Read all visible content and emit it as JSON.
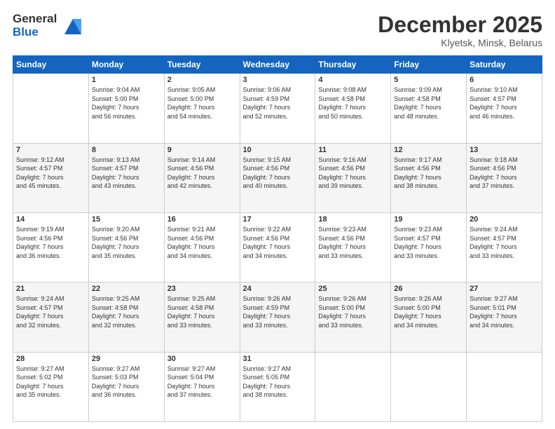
{
  "logo": {
    "general": "General",
    "blue": "Blue"
  },
  "header": {
    "month": "December 2025",
    "location": "Klyetsk, Minsk, Belarus"
  },
  "weekdays": [
    "Sunday",
    "Monday",
    "Tuesday",
    "Wednesday",
    "Thursday",
    "Friday",
    "Saturday"
  ],
  "weeks": [
    [
      {
        "day": "",
        "info": ""
      },
      {
        "day": "1",
        "info": "Sunrise: 9:04 AM\nSunset: 5:00 PM\nDaylight: 7 hours\nand 56 minutes."
      },
      {
        "day": "2",
        "info": "Sunrise: 9:05 AM\nSunset: 5:00 PM\nDaylight: 7 hours\nand 54 minutes."
      },
      {
        "day": "3",
        "info": "Sunrise: 9:06 AM\nSunset: 4:59 PM\nDaylight: 7 hours\nand 52 minutes."
      },
      {
        "day": "4",
        "info": "Sunrise: 9:08 AM\nSunset: 4:58 PM\nDaylight: 7 hours\nand 50 minutes."
      },
      {
        "day": "5",
        "info": "Sunrise: 9:09 AM\nSunset: 4:58 PM\nDaylight: 7 hours\nand 48 minutes."
      },
      {
        "day": "6",
        "info": "Sunrise: 9:10 AM\nSunset: 4:57 PM\nDaylight: 7 hours\nand 46 minutes."
      }
    ],
    [
      {
        "day": "7",
        "info": "Sunrise: 9:12 AM\nSunset: 4:57 PM\nDaylight: 7 hours\nand 45 minutes."
      },
      {
        "day": "8",
        "info": "Sunrise: 9:13 AM\nSunset: 4:57 PM\nDaylight: 7 hours\nand 43 minutes."
      },
      {
        "day": "9",
        "info": "Sunrise: 9:14 AM\nSunset: 4:56 PM\nDaylight: 7 hours\nand 42 minutes."
      },
      {
        "day": "10",
        "info": "Sunrise: 9:15 AM\nSunset: 4:56 PM\nDaylight: 7 hours\nand 40 minutes."
      },
      {
        "day": "11",
        "info": "Sunrise: 9:16 AM\nSunset: 4:56 PM\nDaylight: 7 hours\nand 39 minutes."
      },
      {
        "day": "12",
        "info": "Sunrise: 9:17 AM\nSunset: 4:56 PM\nDaylight: 7 hours\nand 38 minutes."
      },
      {
        "day": "13",
        "info": "Sunrise: 9:18 AM\nSunset: 4:56 PM\nDaylight: 7 hours\nand 37 minutes."
      }
    ],
    [
      {
        "day": "14",
        "info": "Sunrise: 9:19 AM\nSunset: 4:56 PM\nDaylight: 7 hours\nand 36 minutes."
      },
      {
        "day": "15",
        "info": "Sunrise: 9:20 AM\nSunset: 4:56 PM\nDaylight: 7 hours\nand 35 minutes."
      },
      {
        "day": "16",
        "info": "Sunrise: 9:21 AM\nSunset: 4:56 PM\nDaylight: 7 hours\nand 34 minutes."
      },
      {
        "day": "17",
        "info": "Sunrise: 9:22 AM\nSunset: 4:56 PM\nDaylight: 7 hours\nand 34 minutes."
      },
      {
        "day": "18",
        "info": "Sunrise: 9:23 AM\nSunset: 4:56 PM\nDaylight: 7 hours\nand 33 minutes."
      },
      {
        "day": "19",
        "info": "Sunrise: 9:23 AM\nSunset: 4:57 PM\nDaylight: 7 hours\nand 33 minutes."
      },
      {
        "day": "20",
        "info": "Sunrise: 9:24 AM\nSunset: 4:57 PM\nDaylight: 7 hours\nand 33 minutes."
      }
    ],
    [
      {
        "day": "21",
        "info": "Sunrise: 9:24 AM\nSunset: 4:57 PM\nDaylight: 7 hours\nand 32 minutes."
      },
      {
        "day": "22",
        "info": "Sunrise: 9:25 AM\nSunset: 4:58 PM\nDaylight: 7 hours\nand 32 minutes."
      },
      {
        "day": "23",
        "info": "Sunrise: 9:25 AM\nSunset: 4:58 PM\nDaylight: 7 hours\nand 33 minutes."
      },
      {
        "day": "24",
        "info": "Sunrise: 9:26 AM\nSunset: 4:59 PM\nDaylight: 7 hours\nand 33 minutes."
      },
      {
        "day": "25",
        "info": "Sunrise: 9:26 AM\nSunset: 5:00 PM\nDaylight: 7 hours\nand 33 minutes."
      },
      {
        "day": "26",
        "info": "Sunrise: 9:26 AM\nSunset: 5:00 PM\nDaylight: 7 hours\nand 34 minutes."
      },
      {
        "day": "27",
        "info": "Sunrise: 9:27 AM\nSunset: 5:01 PM\nDaylight: 7 hours\nand 34 minutes."
      }
    ],
    [
      {
        "day": "28",
        "info": "Sunrise: 9:27 AM\nSunset: 5:02 PM\nDaylight: 7 hours\nand 35 minutes."
      },
      {
        "day": "29",
        "info": "Sunrise: 9:27 AM\nSunset: 5:03 PM\nDaylight: 7 hours\nand 36 minutes."
      },
      {
        "day": "30",
        "info": "Sunrise: 9:27 AM\nSunset: 5:04 PM\nDaylight: 7 hours\nand 37 minutes."
      },
      {
        "day": "31",
        "info": "Sunrise: 9:27 AM\nSunset: 5:05 PM\nDaylight: 7 hours\nand 38 minutes."
      },
      {
        "day": "",
        "info": ""
      },
      {
        "day": "",
        "info": ""
      },
      {
        "day": "",
        "info": ""
      }
    ]
  ]
}
